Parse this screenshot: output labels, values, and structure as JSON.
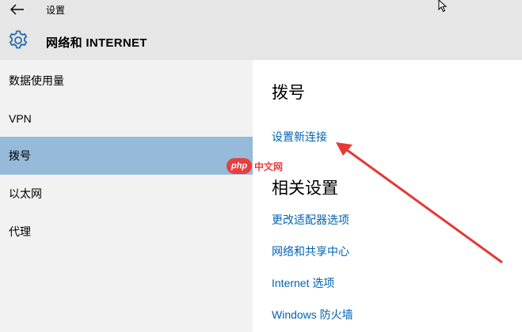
{
  "window": {
    "title": "设置",
    "back_icon": "back-arrow-icon"
  },
  "section": {
    "icon": "gear-icon",
    "title": "网络和 INTERNET"
  },
  "sidebar": {
    "items": [
      {
        "label": "数据使用量",
        "active": false
      },
      {
        "label": "VPN",
        "active": false
      },
      {
        "label": "拨号",
        "active": true
      },
      {
        "label": "以太网",
        "active": false
      },
      {
        "label": "代理",
        "active": false
      }
    ],
    "active_color": "#95bada"
  },
  "main": {
    "heading": "拨号",
    "setup_link": "设置新连接",
    "related_heading": "相关设置",
    "related_links": [
      "更改适配器选项",
      "网络和共享中心",
      "Internet 选项",
      "Windows 防火墙"
    ],
    "link_color": "#0063b1"
  },
  "watermark": {
    "badge": "php",
    "text": "中文网"
  },
  "annotation": {
    "arrow_color": "#e53935"
  }
}
